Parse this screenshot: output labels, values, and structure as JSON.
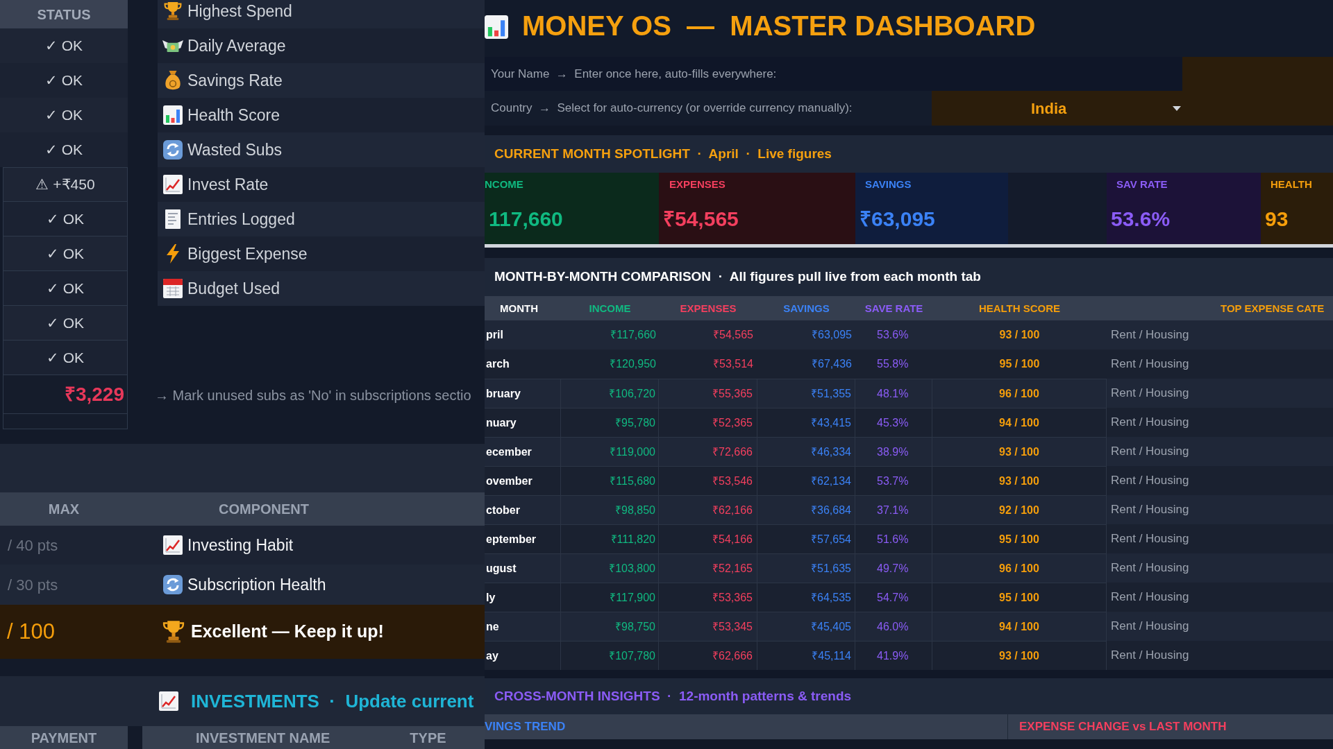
{
  "status_table": {
    "header": "STATUS",
    "rows": [
      "✓ OK",
      "✓ OK",
      "✓ OK",
      "✓ OK",
      "⚠ +₹450",
      "✓ OK",
      "✓ OK",
      "✓ OK",
      "✓ OK",
      "✓ OK"
    ],
    "total": "₹3,229"
  },
  "metrics": {
    "items": [
      "Highest Spend",
      "Daily Average",
      "Savings Rate",
      "Health Score",
      "Wasted Subs",
      "Invest Rate",
      "Entries Logged",
      "Biggest Expense",
      "Budget Used"
    ],
    "note": "→ Mark unused subs as 'No' in subscriptions sectio"
  },
  "score_table": {
    "columns": [
      "MAX",
      "COMPONENT"
    ],
    "rows": [
      {
        "max": "/ 40 pts",
        "component": "Investing Habit"
      },
      {
        "max": "/ 30 pts",
        "component": "Subscription Health"
      }
    ],
    "total": {
      "max": "/ 100",
      "rating": "Excellent — Keep it up!"
    }
  },
  "investments": {
    "title": "INVESTMENTS  ·  Update current",
    "columns": [
      "PAYMENT",
      "INVESTMENT NAME",
      "TYPE"
    ]
  },
  "dashboard": {
    "title": "MONEY OS  —  MASTER DASHBOARD",
    "name_field": {
      "label": "Your Name  →  Enter once here, auto-fills everywhere:"
    },
    "country_field": {
      "label": "Country  →  Select for auto-currency (or override currency manually):",
      "value": "India"
    },
    "spotlight": {
      "title": "CURRENT MONTH SPOTLIGHT  ·  April  ·  Live figures",
      "cards": [
        {
          "label": "NCOME",
          "value": "117,660"
        },
        {
          "label": "EXPENSES",
          "value": "₹54,565"
        },
        {
          "label": "SAVINGS",
          "value": "₹63,095"
        },
        {
          "label": "SAV RATE",
          "value": "53.6%"
        },
        {
          "label": "HEALTH",
          "value": "93"
        }
      ]
    },
    "comparison": {
      "title": "MONTH-BY-MONTH COMPARISON  ·  All figures pull live from each month tab",
      "columns": [
        "MONTH",
        "INCOME",
        "EXPENSES",
        "SAVINGS",
        "SAVE RATE",
        "HEALTH SCORE",
        "TOP EXPENSE CATE"
      ],
      "rows": [
        [
          "pril",
          "₹117,660",
          "₹54,565",
          "₹63,095",
          "53.6%",
          "93 / 100",
          "Rent / Housing"
        ],
        [
          "arch",
          "₹120,950",
          "₹53,514",
          "₹67,436",
          "55.8%",
          "95 / 100",
          "Rent / Housing"
        ],
        [
          "bruary",
          "₹106,720",
          "₹55,365",
          "₹51,355",
          "48.1%",
          "96 / 100",
          "Rent / Housing"
        ],
        [
          "nuary",
          "₹95,780",
          "₹52,365",
          "₹43,415",
          "45.3%",
          "94 / 100",
          "Rent / Housing"
        ],
        [
          "ecember",
          "₹119,000",
          "₹72,666",
          "₹46,334",
          "38.9%",
          "93 / 100",
          "Rent / Housing"
        ],
        [
          "ovember",
          "₹115,680",
          "₹53,546",
          "₹62,134",
          "53.7%",
          "93 / 100",
          "Rent / Housing"
        ],
        [
          "ctober",
          "₹98,850",
          "₹62,166",
          "₹36,684",
          "37.1%",
          "92 / 100",
          "Rent / Housing"
        ],
        [
          "eptember",
          "₹111,820",
          "₹54,166",
          "₹57,654",
          "51.6%",
          "95 / 100",
          "Rent / Housing"
        ],
        [
          "ugust",
          "₹103,800",
          "₹52,165",
          "₹51,635",
          "49.7%",
          "96 / 100",
          "Rent / Housing"
        ],
        [
          "ly",
          "₹117,900",
          "₹53,365",
          "₹64,535",
          "54.7%",
          "95 / 100",
          "Rent / Housing"
        ],
        [
          "ne",
          "₹98,750",
          "₹53,345",
          "₹45,405",
          "46.0%",
          "94 / 100",
          "Rent / Housing"
        ],
        [
          "ay",
          "₹107,780",
          "₹62,666",
          "₹45,114",
          "41.9%",
          "93 / 100",
          "Rent / Housing"
        ]
      ]
    },
    "insights": {
      "title": "CROSS-MONTH INSIGHTS  ·  12-month patterns & trends",
      "columns": [
        "VINGS TREND",
        "EXPENSE CHANGE vs LAST MONTH"
      ]
    }
  }
}
